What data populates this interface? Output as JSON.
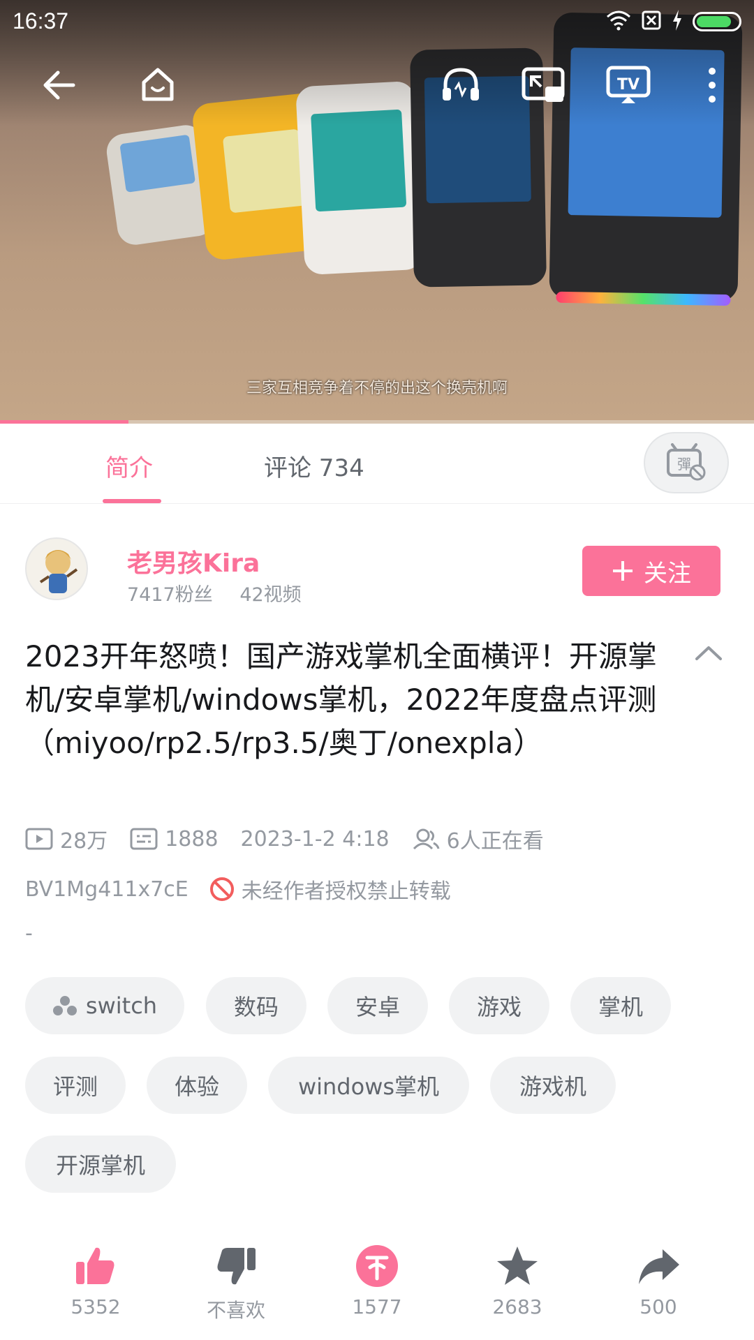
{
  "status_bar": {
    "time": "16:37",
    "battery_level": 0.85
  },
  "video": {
    "subtitle": "三家互相竞争着不停的出这个换壳机啊",
    "watermark": "老男孩Kira",
    "progress": 0.17
  },
  "tabs": {
    "intro": "简介",
    "comments": "评论 734"
  },
  "author": {
    "name": "老男孩Kira",
    "fans": "7417粉丝",
    "videos": "42视频",
    "follow_label": "关注"
  },
  "title": "2023开年怒喷！国产游戏掌机全面横评！开源掌机/安卓掌机/windows掌机，2022年度盘点评测（miyoo/rp2.5/rp3.5/奥丁/onexpla）",
  "stats": {
    "views": "28万",
    "danmaku": "1888",
    "date": "2023-1-2 4:18",
    "watching": "6人正在看"
  },
  "bvid": "BV1Mg411x7cE",
  "reprint_notice": "未经作者授权禁止转载",
  "description": "-",
  "tags": [
    "switch",
    "数码",
    "安卓",
    "游戏",
    "掌机",
    "评测",
    "体验",
    "windows掌机",
    "游戏机",
    "开源掌机"
  ],
  "actions": {
    "like": "5352",
    "dislike": "不喜欢",
    "coin": "1577",
    "favorite": "2683",
    "share": "500"
  },
  "colors": {
    "accent": "#fb7299",
    "muted": "#9499a0",
    "tag_bg": "#f1f2f3"
  }
}
